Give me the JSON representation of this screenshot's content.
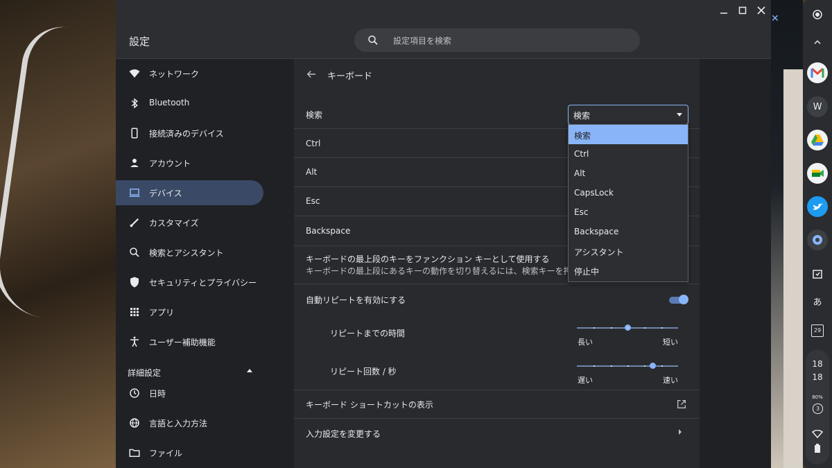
{
  "app": {
    "title": "設定"
  },
  "search": {
    "placeholder": "設定項目を検索"
  },
  "sidebar": {
    "items": [
      {
        "label": "ネットワーク"
      },
      {
        "label": "Bluetooth"
      },
      {
        "label": "接続済みのデバイス"
      },
      {
        "label": "アカウント"
      },
      {
        "label": "デバイス"
      },
      {
        "label": "カスタマイズ"
      },
      {
        "label": "検索とアシスタント"
      },
      {
        "label": "セキュリティとプライバシー"
      },
      {
        "label": "アプリ"
      },
      {
        "label": "ユーザー補助機能"
      }
    ],
    "advanced_label": "詳細設定",
    "advanced_items": [
      {
        "label": "日時"
      },
      {
        "label": "言語と入力方法"
      },
      {
        "label": "ファイル"
      }
    ]
  },
  "main": {
    "page_title": "キーボード",
    "rows": [
      {
        "label": "検索"
      },
      {
        "label": "Ctrl"
      },
      {
        "label": "Alt"
      },
      {
        "label": "Esc"
      },
      {
        "label": "Backspace"
      }
    ],
    "function_keys": {
      "label": "キーボードの最上段のキーをファンクション キーとして使用する",
      "sub": "キーボードの最上段にあるキーの動作を切り替えるには、検索キーを押した"
    },
    "auto_repeat": {
      "label": "自動リピートを有効にする",
      "enabled": true
    },
    "repeat_delay": {
      "label": "リピートまでの時間",
      "min_label": "長い",
      "max_label": "短い",
      "level": 0.5
    },
    "repeat_rate": {
      "label": "リピート回数 / 秒",
      "min_label": "遅い",
      "max_label": "速い",
      "level": 0.75
    },
    "shortcuts_label": "キーボード ショートカットの表示",
    "input_settings_label": "入力設定を変更する",
    "select_value": "検索",
    "dropdown_options": [
      "検索",
      "Ctrl",
      "Alt",
      "CapsLock",
      "Esc",
      "Backspace",
      "アシスタント",
      "停止中"
    ]
  },
  "shelf": {
    "w_label": "W",
    "ime_label": "あ",
    "calendar_day": "29",
    "time_hour": "18",
    "time_min": "18",
    "battery": "80%",
    "notifications": "3"
  },
  "colors": {
    "accent": "#8ab4f8",
    "active_nav": "#3a4a66"
  }
}
